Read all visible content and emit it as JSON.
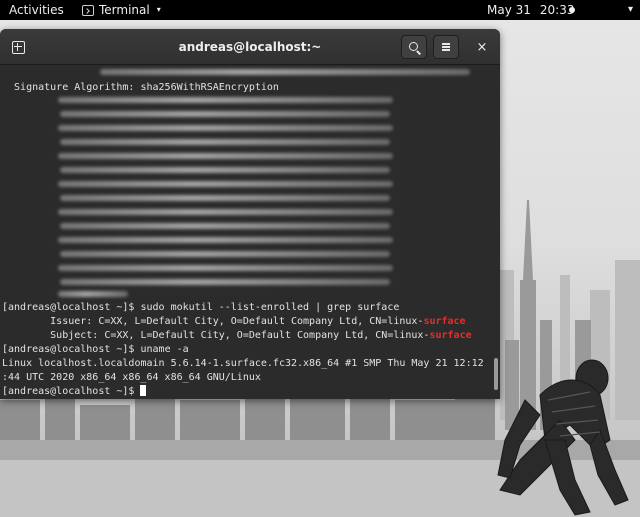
{
  "topbar": {
    "activities": "Activities",
    "app_name": "Terminal",
    "date": "May 31",
    "time": "20:33",
    "caret": "▾",
    "power": "▾"
  },
  "window": {
    "title": "andreas@localhost:~",
    "close": "×"
  },
  "terminal": {
    "signature_line": "  Signature Algorithm: sha256WithRSAEncryption",
    "command_lines": [
      {
        "prompt": "[andreas@localhost ~]$ ",
        "text": "sudo mokutil --list-enrolled | grep surface"
      },
      {
        "prompt": "",
        "text": "        Issuer: C=XX, L=Default City, O=Default Company Ltd, CN=linux-",
        "highlight": "surface"
      },
      {
        "prompt": "",
        "text": "        Subject: C=XX, L=Default City, O=Default Company Ltd, CN=linux-",
        "highlight": "surface"
      },
      {
        "prompt": "[andreas@localhost ~]$ ",
        "text": "uname -a"
      },
      {
        "prompt": "",
        "text": "Linux localhost.localdomain 5.6.14-1.surface.fc32.x86_64 #1 SMP Thu May 21 12:12"
      },
      {
        "prompt": "",
        "text": ":44 UTC 2020 x86_64 x86_64 x86_64 GNU/Linux"
      },
      {
        "prompt": "[andreas@localhost ~]$ ",
        "text": ""
      }
    ],
    "highlight_color": "#ef2929"
  },
  "icons": {
    "new_tab": "new-tab-icon",
    "search": "search-icon",
    "menu": "hamburger-menu-icon",
    "close": "close-icon",
    "app": "terminal-app-icon"
  }
}
